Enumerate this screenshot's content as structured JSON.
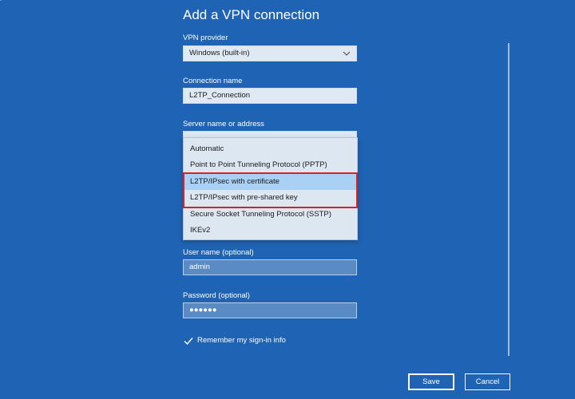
{
  "page": {
    "title": "Add a VPN connection"
  },
  "form": {
    "vpn_provider": {
      "label": "VPN provider",
      "value": "Windows (built-in)"
    },
    "connection_name": {
      "label": "Connection name",
      "value": "L2TP_Connection"
    },
    "server": {
      "label": "Server name or address",
      "value": ""
    },
    "vpn_type_options": [
      {
        "label": "Automatic",
        "selected": false
      },
      {
        "label": "Point to Point Tunneling Protocol (PPTP)",
        "selected": false
      },
      {
        "label": "L2TP/IPsec with certificate",
        "selected": true
      },
      {
        "label": "L2TP/IPsec with pre-shared key",
        "selected": false
      },
      {
        "label": "Secure Socket Tunneling Protocol (SSTP)",
        "selected": false
      },
      {
        "label": "IKEv2",
        "selected": false
      }
    ],
    "username": {
      "label": "User name (optional)",
      "value": "admin"
    },
    "password": {
      "label": "Password (optional)",
      "value": "●●●●●●"
    },
    "remember": {
      "label": "Remember my sign-in info",
      "checked": true
    }
  },
  "buttons": {
    "save": "Save",
    "cancel": "Cancel"
  },
  "colors": {
    "background": "#1f63b4",
    "selected_item": "#a8d1f5",
    "annotation_box": "#e02020"
  },
  "icons": {
    "dropdown": "chevron-down-icon",
    "checkbox": "checkmark-icon"
  }
}
